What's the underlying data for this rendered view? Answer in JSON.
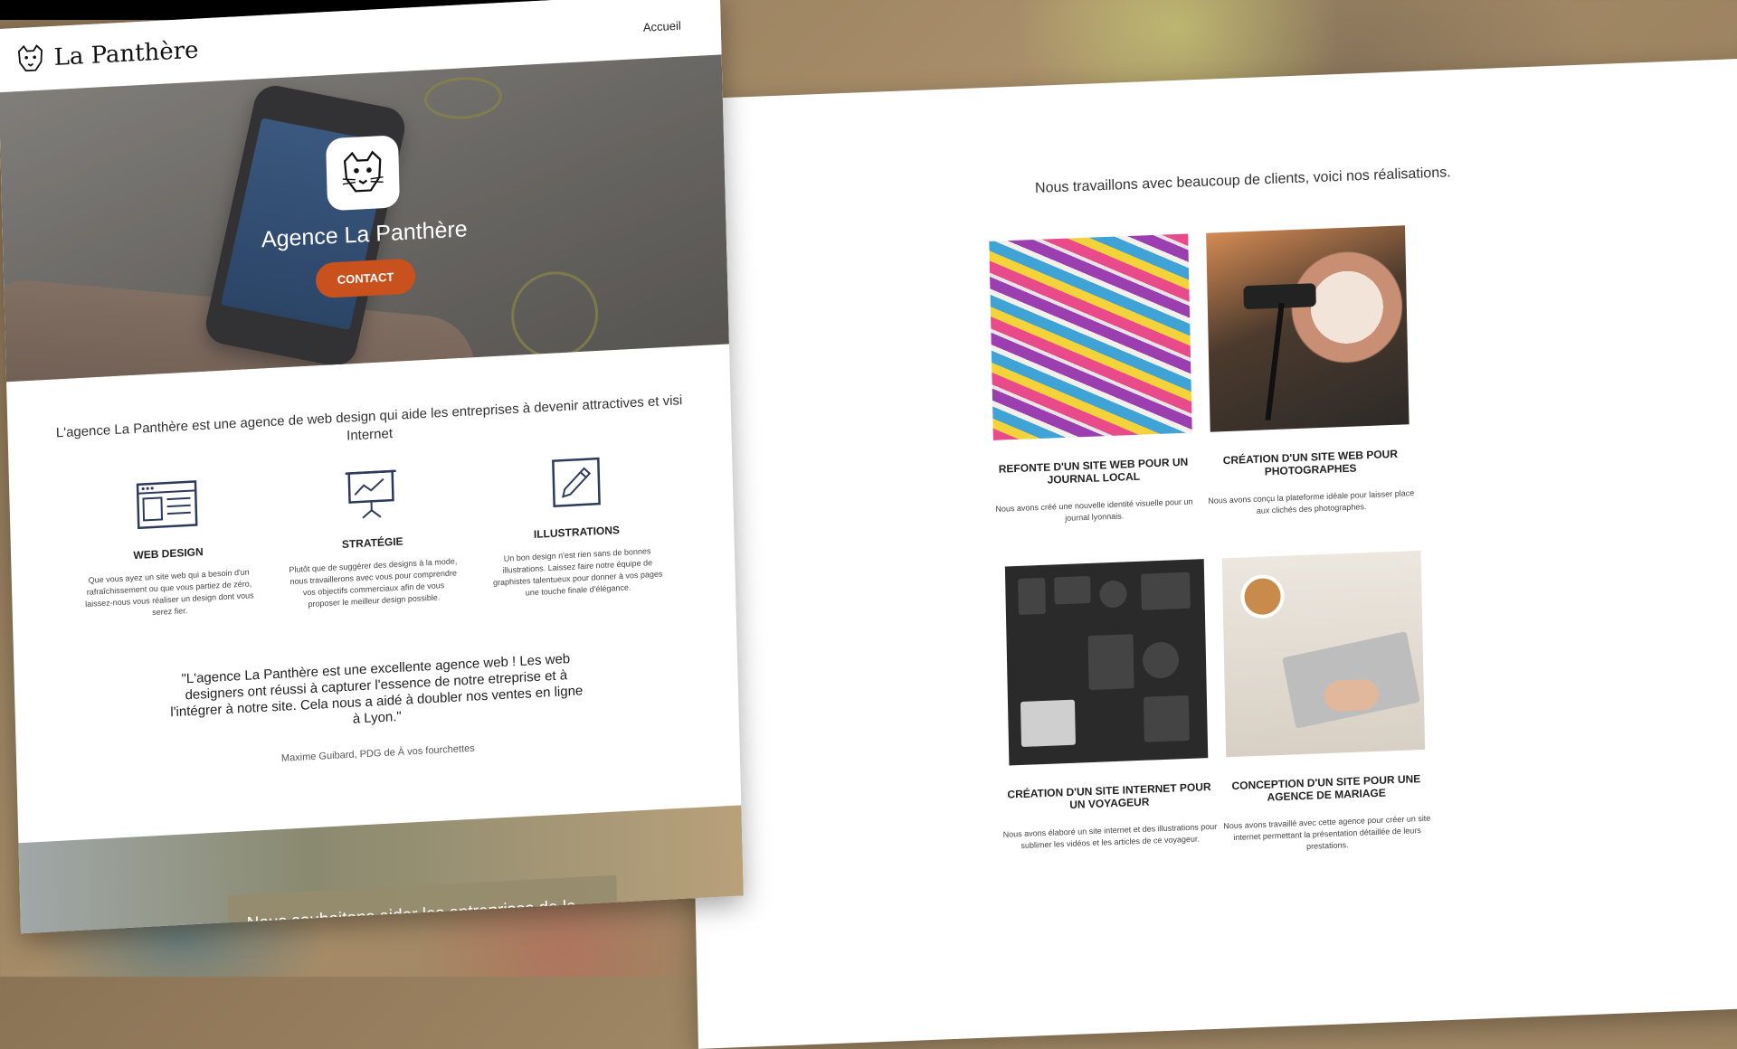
{
  "brand": {
    "name": "La Panthère"
  },
  "nav": {
    "home": "Accueil"
  },
  "hero": {
    "title": "Agence La Panthère",
    "cta": "CONTACT"
  },
  "intro": {
    "text": "L'agence La Panthère est une agence de web design qui aide les entreprises à devenir attractives et visi Internet"
  },
  "services": [
    {
      "icon": "browser-window-icon",
      "title": "WEB DESIGN",
      "desc": "Que vous ayez un site web qui a besoin d'un rafraîchissement ou que vous partiez de zéro, laissez-nous vous réaliser un design dont vous serez fier."
    },
    {
      "icon": "presentation-chart-icon",
      "title": "STRATÉGIE",
      "desc": "Plutôt que de suggérer des designs à la mode, nous travaillerons avec vous pour comprendre vos objectifs commerciaux afin de vous proposer le meilleur design possible."
    },
    {
      "icon": "pencil-icon",
      "title": "ILLUSTRATIONS",
      "desc": "Un bon design n'est rien sans de bonnes illustrations. Laissez faire notre équipe de graphistes talentueux pour donner à vos pages une touche finale d'élégance."
    }
  ],
  "testimonial": {
    "quote": "\"L'agence La Panthère est une excellente agence web ! Les web designers ont réussi à capturer l'essence de notre etreprise et à l'intégrer à notre site. Cela nous a aidé à doubler nos ventes en ligne à Lyon.\"",
    "author": "Maxime Guibard, PDG de À vos fourchettes"
  },
  "bottom": {
    "text": "Nous souhaitons aider les entreprises de la région"
  },
  "works": {
    "lead": "Nous travaillons avec beaucoup de clients, voici nos réalisations.",
    "items": [
      {
        "title": "REFONTE D'UN SITE WEB POUR UN JOURNAL LOCAL",
        "desc": "Nous avons créé une nouvelle identité visuelle pour un journal lyonnais."
      },
      {
        "title": "CRÉATION D'UN SITE WEB POUR PHOTOGRAPHES",
        "desc": "Nous avons conçu la plateforme idéale pour laisser place aux clichés des photographes."
      },
      {
        "title": "CRÉATION D'UN SITE INTERNET POUR UN VOYAGEUR",
        "desc": "Nous avons élaboré un site internet et des illustrations pour sublimer les vidéos et les articles de ce voyageur."
      },
      {
        "title": "CONCEPTION D'UN SITE POUR UNE AGENCE DE MARIAGE",
        "desc": "Nous avons travaillé avec cette agence pour créer un site internet permettant la présentation détaillée de leurs prestations."
      }
    ]
  },
  "colors": {
    "accent": "#c9511d",
    "icon": "#2e3a5c"
  }
}
